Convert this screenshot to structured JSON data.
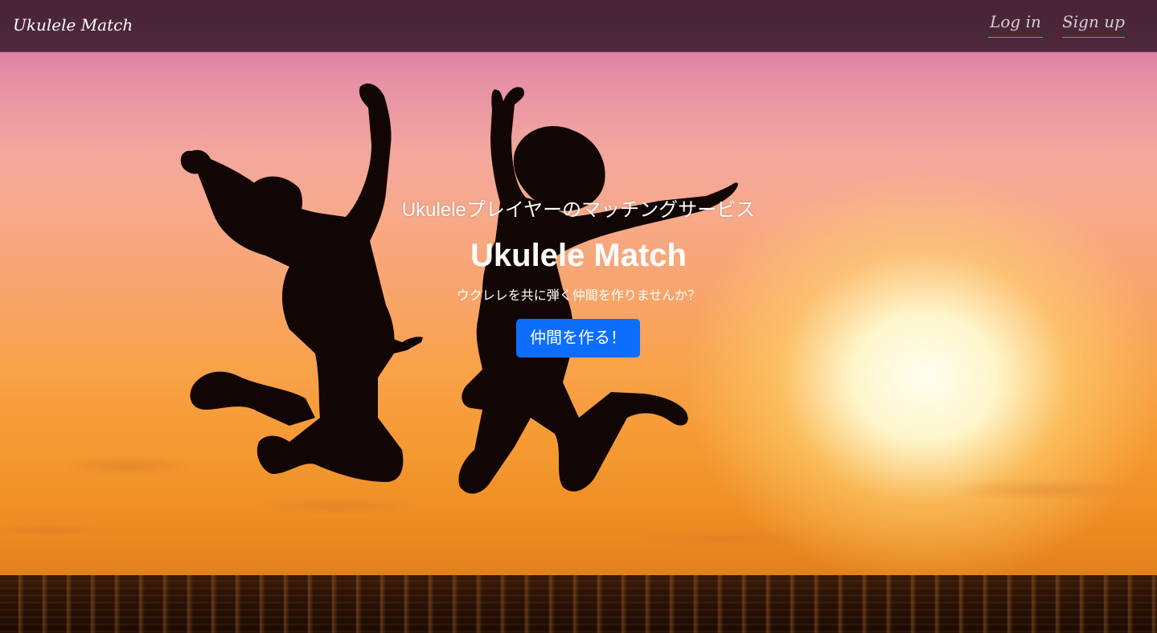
{
  "navbar": {
    "brand": "Ukulele Match",
    "login_label": "Log in",
    "signup_label": "Sign up"
  },
  "hero": {
    "tagline": "Ukuleleプレイヤーのマッチングサービス",
    "title": "Ukulele Match",
    "subtitle": "ウクレレを共に弾く仲間を作りませんか？",
    "cta_label": "仲間を作る！"
  },
  "colors": {
    "navbar_bg": "#341a28",
    "nav_underline": "#2fbf58",
    "cta_bg": "#0d6efd"
  }
}
